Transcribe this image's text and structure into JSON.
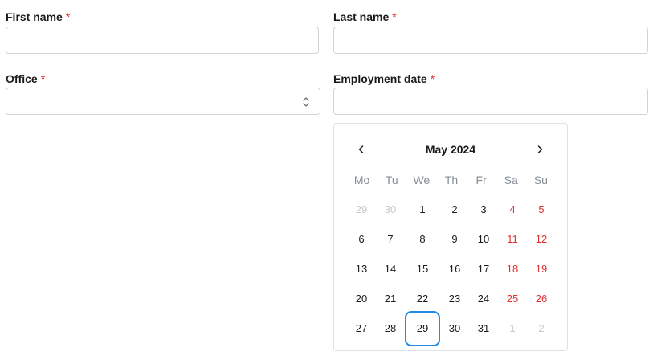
{
  "form": {
    "first_name": {
      "label": "First name",
      "required_mark": "*",
      "value": ""
    },
    "last_name": {
      "label": "Last name",
      "required_mark": "*",
      "value": ""
    },
    "office": {
      "label": "Office",
      "required_mark": "*",
      "value": ""
    },
    "employment_date": {
      "label": "Employment date",
      "required_mark": "*",
      "value": ""
    }
  },
  "calendar": {
    "month_label": "May 2024",
    "weekdays": [
      "Mo",
      "Tu",
      "We",
      "Th",
      "Fr",
      "Sa",
      "Su"
    ],
    "weeks": [
      [
        {
          "day": "29",
          "outside": true,
          "weekend": false
        },
        {
          "day": "30",
          "outside": true,
          "weekend": false
        },
        {
          "day": "1",
          "outside": false,
          "weekend": false
        },
        {
          "day": "2",
          "outside": false,
          "weekend": false
        },
        {
          "day": "3",
          "outside": false,
          "weekend": false
        },
        {
          "day": "4",
          "outside": false,
          "weekend": true
        },
        {
          "day": "5",
          "outside": false,
          "weekend": true
        }
      ],
      [
        {
          "day": "6",
          "outside": false,
          "weekend": false
        },
        {
          "day": "7",
          "outside": false,
          "weekend": false
        },
        {
          "day": "8",
          "outside": false,
          "weekend": false
        },
        {
          "day": "9",
          "outside": false,
          "weekend": false
        },
        {
          "day": "10",
          "outside": false,
          "weekend": false
        },
        {
          "day": "11",
          "outside": false,
          "weekend": true
        },
        {
          "day": "12",
          "outside": false,
          "weekend": true
        }
      ],
      [
        {
          "day": "13",
          "outside": false,
          "weekend": false
        },
        {
          "day": "14",
          "outside": false,
          "weekend": false
        },
        {
          "day": "15",
          "outside": false,
          "weekend": false
        },
        {
          "day": "16",
          "outside": false,
          "weekend": false
        },
        {
          "day": "17",
          "outside": false,
          "weekend": false
        },
        {
          "day": "18",
          "outside": false,
          "weekend": true
        },
        {
          "day": "19",
          "outside": false,
          "weekend": true
        }
      ],
      [
        {
          "day": "20",
          "outside": false,
          "weekend": false
        },
        {
          "day": "21",
          "outside": false,
          "weekend": false
        },
        {
          "day": "22",
          "outside": false,
          "weekend": false
        },
        {
          "day": "23",
          "outside": false,
          "weekend": false
        },
        {
          "day": "24",
          "outside": false,
          "weekend": false
        },
        {
          "day": "25",
          "outside": false,
          "weekend": true
        },
        {
          "day": "26",
          "outside": false,
          "weekend": true
        }
      ],
      [
        {
          "day": "27",
          "outside": false,
          "weekend": false
        },
        {
          "day": "28",
          "outside": false,
          "weekend": false
        },
        {
          "day": "29",
          "outside": false,
          "weekend": false,
          "selected": true
        },
        {
          "day": "30",
          "outside": false,
          "weekend": false
        },
        {
          "day": "31",
          "outside": false,
          "weekend": false
        },
        {
          "day": "1",
          "outside": true,
          "weekend": true
        },
        {
          "day": "2",
          "outside": true,
          "weekend": true
        }
      ]
    ],
    "prev_icon": "chevron-left-icon",
    "next_icon": "chevron-right-icon"
  },
  "colors": {
    "required": "#e03131",
    "weekend": "#e03131",
    "selected_border": "#228be6",
    "outside_day": "#c4c8cc",
    "weekday_header": "#868e96",
    "input_border": "#ced4da"
  }
}
